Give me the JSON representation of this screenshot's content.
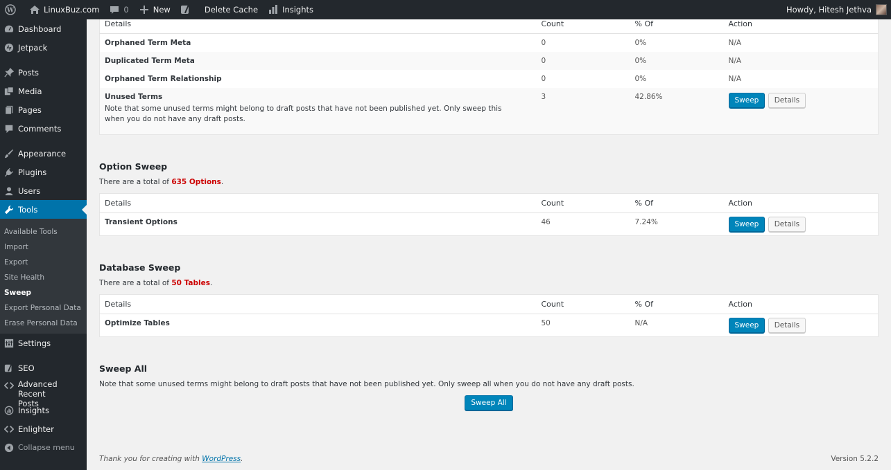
{
  "adminbar": {
    "site_name": "LinuxBuz.com",
    "comments_count": "0",
    "new_label": "New",
    "delete_cache_label": "Delete Cache",
    "insights_label": "Insights",
    "howdy": "Howdy, Hitesh Jethva"
  },
  "sidebar": {
    "dashboard": "Dashboard",
    "jetpack": "Jetpack",
    "posts": "Posts",
    "media": "Media",
    "pages": "Pages",
    "comments": "Comments",
    "appearance": "Appearance",
    "plugins": "Plugins",
    "users": "Users",
    "tools": "Tools",
    "tools_sub": [
      "Available Tools",
      "Import",
      "Export",
      "Site Health",
      "Sweep",
      "Export Personal Data",
      "Erase Personal Data"
    ],
    "settings": "Settings",
    "seo": "SEO",
    "advanced_recent_posts_1": "Advanced Recent",
    "advanced_recent_posts_2": "Posts",
    "insights": "Insights",
    "enlighter": "Enlighter",
    "collapse": "Collapse menu"
  },
  "headers": {
    "details": "Details",
    "count": "Count",
    "percent": "% Of",
    "action": "Action"
  },
  "term_table": {
    "rows": [
      {
        "name": "Orphaned Term Meta",
        "count": "0",
        "percent": "0%",
        "action": "N/A"
      },
      {
        "name": "Duplicated Term Meta",
        "count": "0",
        "percent": "0%",
        "action": "N/A"
      },
      {
        "name": "Orphaned Term Relationship",
        "count": "0",
        "percent": "0%",
        "action": "N/A"
      }
    ],
    "unused": {
      "name": "Unused Terms",
      "note": "Note that some unused terms might belong to draft posts that have not been published yet. Only sweep this when you do not have any draft posts.",
      "count": "3",
      "percent": "42.86%"
    }
  },
  "buttons": {
    "sweep": "Sweep",
    "details": "Details",
    "sweep_all": "Sweep All"
  },
  "option_sweep": {
    "title": "Option Sweep",
    "total_prefix": "There are a total of ",
    "total_value": "635 Options",
    "total_suffix": ".",
    "row": {
      "name": "Transient Options",
      "count": "46",
      "percent": "7.24%"
    }
  },
  "database_sweep": {
    "title": "Database Sweep",
    "total_prefix": "There are a total of ",
    "total_value": "50 Tables",
    "total_suffix": ".",
    "row": {
      "name": "Optimize Tables",
      "count": "50",
      "percent": "N/A"
    }
  },
  "sweep_all": {
    "title": "Sweep All",
    "note": "Note that some unused terms might belong to draft posts that have not been published yet. Only sweep all when you do not have any draft posts."
  },
  "footer": {
    "thanks_prefix": "Thank you for creating with ",
    "wordpress_link": "WordPress",
    "thanks_suffix": ".",
    "version": "Version 5.2.2"
  }
}
